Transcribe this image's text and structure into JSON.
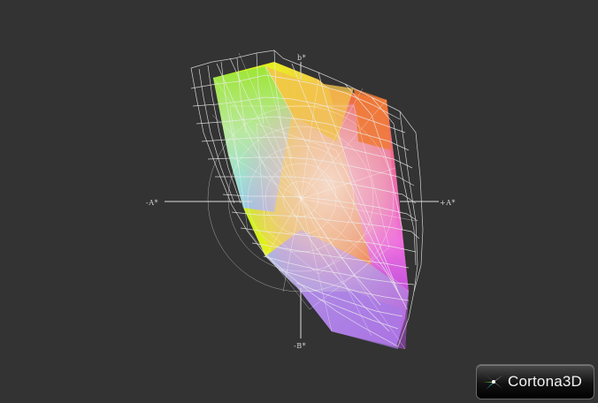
{
  "viewer": {
    "axis_labels": {
      "b_plus": "b*",
      "a_minus": "-A*",
      "a_plus": "+A*",
      "b_minus": "-B*"
    },
    "logo": {
      "text": "Cortona3D",
      "icon": "cortona3d-logo-icon"
    },
    "colors": {
      "background": "#333333",
      "wireframe": "#e8e8e8",
      "axis": "#dcdcdc"
    }
  }
}
